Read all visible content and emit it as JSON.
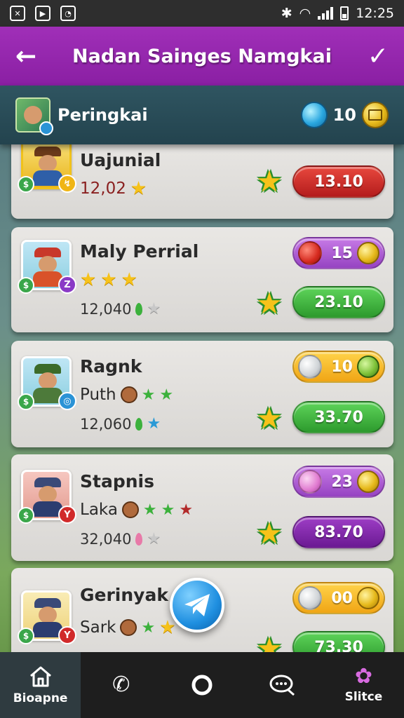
{
  "status_bar": {
    "time": "12:25",
    "left_icons": [
      "close-square-icon",
      "play-square-icon",
      "clock-square-icon"
    ],
    "right_icons": [
      "bluetooth-icon",
      "wifi-icon",
      "signal-icon",
      "battery-icon"
    ]
  },
  "app_bar": {
    "title": "Nadan Sainges Namgkai",
    "back_icon": "arrow-left-icon",
    "confirm_icon": "check-icon"
  },
  "sub_header": {
    "title": "Peringkai",
    "gem_count": "10",
    "gem_icon": "blue-gem-icon",
    "coin_icon": "gold-coin-icon"
  },
  "players": [
    {
      "name": "Uajunial",
      "score": "12,02",
      "button_label": "13.10",
      "button_color": "#c8262a"
    },
    {
      "name": "Maly Perrial",
      "score": "12,040",
      "pill_count": "15",
      "button_label": "23.10",
      "button_color": "#39b139"
    },
    {
      "name": "Ragnk",
      "subtitle": "Puth",
      "score": "12,060",
      "pill_count": "10",
      "button_label": "33.70",
      "button_color": "#39b139"
    },
    {
      "name": "Stapnis",
      "subtitle": "Laka",
      "score": "32,040",
      "pill_count": "23",
      "button_label": "83.70",
      "button_color": "#7b2aa3"
    },
    {
      "name": "Gerinyak",
      "subtitle": "Sark",
      "score": "",
      "pill_count": "00",
      "button_label": "73.30",
      "button_color": "#39b139"
    }
  ],
  "bottom_nav": [
    {
      "label": "Bioapne",
      "icon": "home-icon"
    },
    {
      "label": "",
      "icon": "phone-icon"
    },
    {
      "label": "",
      "icon": "circle-icon"
    },
    {
      "label": "",
      "icon": "chat-search-icon"
    },
    {
      "label": "Slitce",
      "icon": "sparkle-icon"
    }
  ]
}
